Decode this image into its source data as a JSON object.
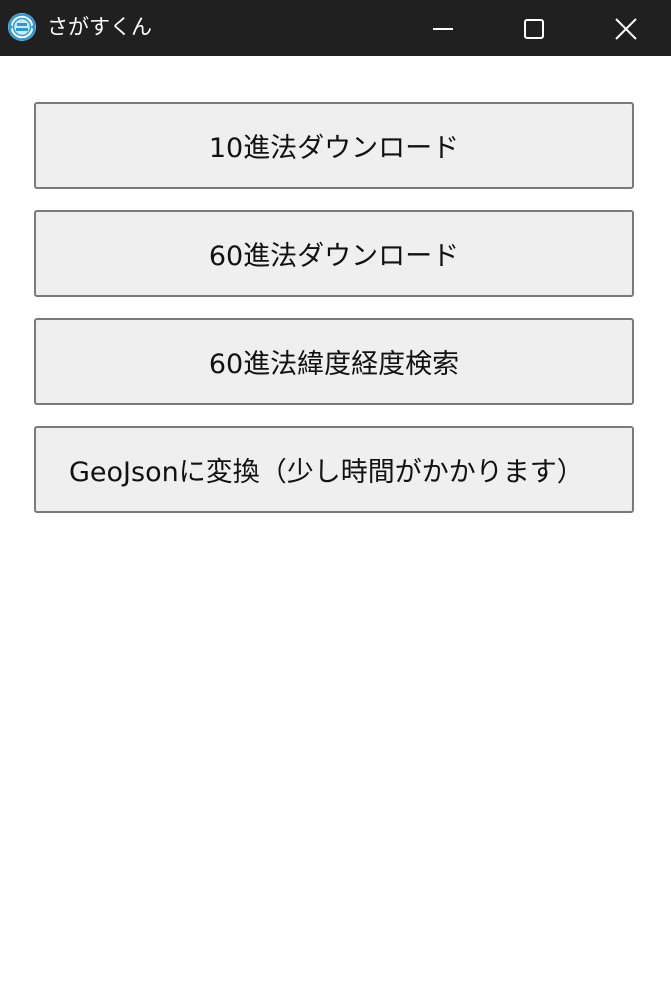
{
  "window": {
    "title": "さがすくん",
    "icon": "sagasukun-app-icon",
    "controls": {
      "minimize_icon": "minimize-icon",
      "maximize_icon": "maximize-icon",
      "close_icon": "close-icon"
    }
  },
  "buttons": [
    {
      "label": "10進法ダウンロード"
    },
    {
      "label": "60進法ダウンロード"
    },
    {
      "label": "60進法緯度経度検索"
    },
    {
      "label": "GeoJsonに変換（少し時間がかかります）"
    }
  ],
  "colors": {
    "titlebar": "#202020",
    "button_face": "#efefef",
    "button_border": "#7a7a7a",
    "app_icon": "#2a9ad6"
  }
}
